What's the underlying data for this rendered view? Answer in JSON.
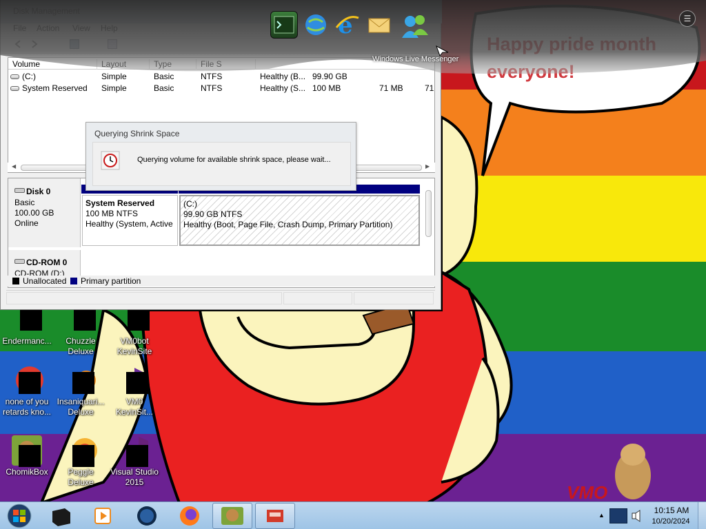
{
  "desktop": {
    "bubble_text": "Happy pride month everyone!",
    "watermark": "VMO"
  },
  "dock": {
    "caption": "Windows Live Messenger",
    "items": [
      {
        "name": "terminal-icon"
      },
      {
        "name": "globe-icon"
      },
      {
        "name": "internet-explorer-icon"
      },
      {
        "name": "mail-icon"
      },
      {
        "name": "windows-live-messenger-icon"
      }
    ]
  },
  "disk_management": {
    "title": "Disk Management",
    "menu": [
      "File",
      "Action",
      "View",
      "Help"
    ],
    "volume_columns": [
      "Volume",
      "Layout",
      "Type",
      "File S",
      "",
      "",
      "",
      ""
    ],
    "volumes": [
      {
        "volume": "(C:)",
        "layout": "Simple",
        "type": "Basic",
        "fs": "NTFS",
        "status": "Healthy (B...",
        "capacity": "99.90 GB",
        "free": "",
        "pct": ""
      },
      {
        "volume": "System Reserved",
        "layout": "Simple",
        "type": "Basic",
        "fs": "NTFS",
        "status": "Healthy (S...",
        "capacity": "100 MB",
        "free": "71 MB",
        "pct": "71"
      }
    ],
    "disks": [
      {
        "name": "Disk 0",
        "lines": [
          "Basic",
          "100.00 GB",
          "Online"
        ],
        "partitions": [
          {
            "title": "System Reserved",
            "lines": [
              "100 MB NTFS",
              "Healthy (System, Active"
            ]
          },
          {
            "title": "(C:)",
            "lines": [
              "99.90 GB NTFS",
              "Healthy (Boot, Page File, Crash Dump, Primary Partition)"
            ]
          }
        ]
      },
      {
        "name": "CD-ROM 0",
        "lines": [
          "CD-ROM (D:)"
        ]
      }
    ],
    "legend": [
      {
        "label": "Unallocated",
        "color": "#000000"
      },
      {
        "label": "Primary partition",
        "color": "#000080"
      }
    ]
  },
  "dialog": {
    "title": "Querying Shrink Space",
    "message": "Querying volume for available shrink space, please wait..."
  },
  "desktop_icons": [
    {
      "label": "Endermanc...",
      "name": "desktop-icon-endermanch"
    },
    {
      "label": "Chuzzle\nDeluxe",
      "name": "desktop-icon-chuzzle-deluxe"
    },
    {
      "label": "VM0bot\nKevinSite",
      "name": "desktop-icon-vm0bot-kevinsite"
    },
    {
      "label": "none of you\nretards kno...",
      "name": "desktop-icon-none-of-you"
    },
    {
      "label": "Insaniquari...\nDeluxe",
      "name": "desktop-icon-insaniquarium-deluxe"
    },
    {
      "label": "VM0\nKevinSit...",
      "name": "desktop-icon-vm0-kevinsite"
    },
    {
      "label": "ChomikBox",
      "name": "desktop-icon-chomikbox"
    },
    {
      "label": "Peggle Deluxe",
      "name": "desktop-icon-peggle-deluxe"
    },
    {
      "label": "Visual Studio\n2015",
      "name": "desktop-icon-visual-studio-2015"
    }
  ],
  "taskbar": {
    "items": [
      {
        "name": "taskbar-terminal"
      },
      {
        "name": "taskbar-media-player"
      },
      {
        "name": "taskbar-globe"
      },
      {
        "name": "taskbar-firefox"
      },
      {
        "name": "taskbar-chomikbox"
      },
      {
        "name": "taskbar-disk-management"
      }
    ],
    "clock_time": "10:15 AM",
    "clock_date": "10/20/2024"
  }
}
